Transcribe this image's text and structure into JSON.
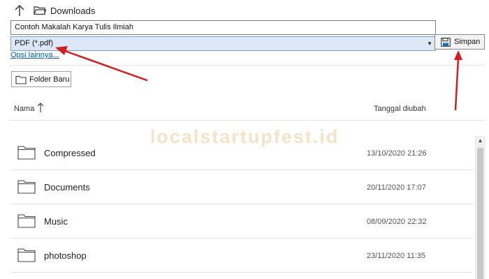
{
  "nav": {
    "location": "Downloads",
    "up_icon": "arrow-up-icon",
    "folder_icon": "folder-open-icon"
  },
  "form": {
    "filename_value": "Contoh Makalah Karya Tulis Ilmiah",
    "filetype_value": "PDF (*.pdf)",
    "more_options_label": "Opsi lainnya...",
    "save_label": "Simpan",
    "save_icon": "save-disk-icon"
  },
  "toolbar": {
    "new_folder_label": "Folder Baru",
    "new_folder_icon": "folder-icon"
  },
  "columns": {
    "name": "Nama",
    "date": "Tanggal diubah",
    "sort_icon": "sort-ascending-icon"
  },
  "watermark": "localstartupfest.id",
  "files": [
    {
      "name": "Compressed",
      "date": "13/10/2020 21:26"
    },
    {
      "name": "Documents",
      "date": "20/11/2020 17:07"
    },
    {
      "name": "Music",
      "date": "08/09/2020 22:32"
    },
    {
      "name": "photoshop",
      "date": "23/11/2020 11:35"
    }
  ],
  "colors": {
    "accent_select": "#dce8f7",
    "annotation_arrow": "#d21f1f",
    "link": "#0b57b5",
    "watermark": "#f6e3c7"
  }
}
